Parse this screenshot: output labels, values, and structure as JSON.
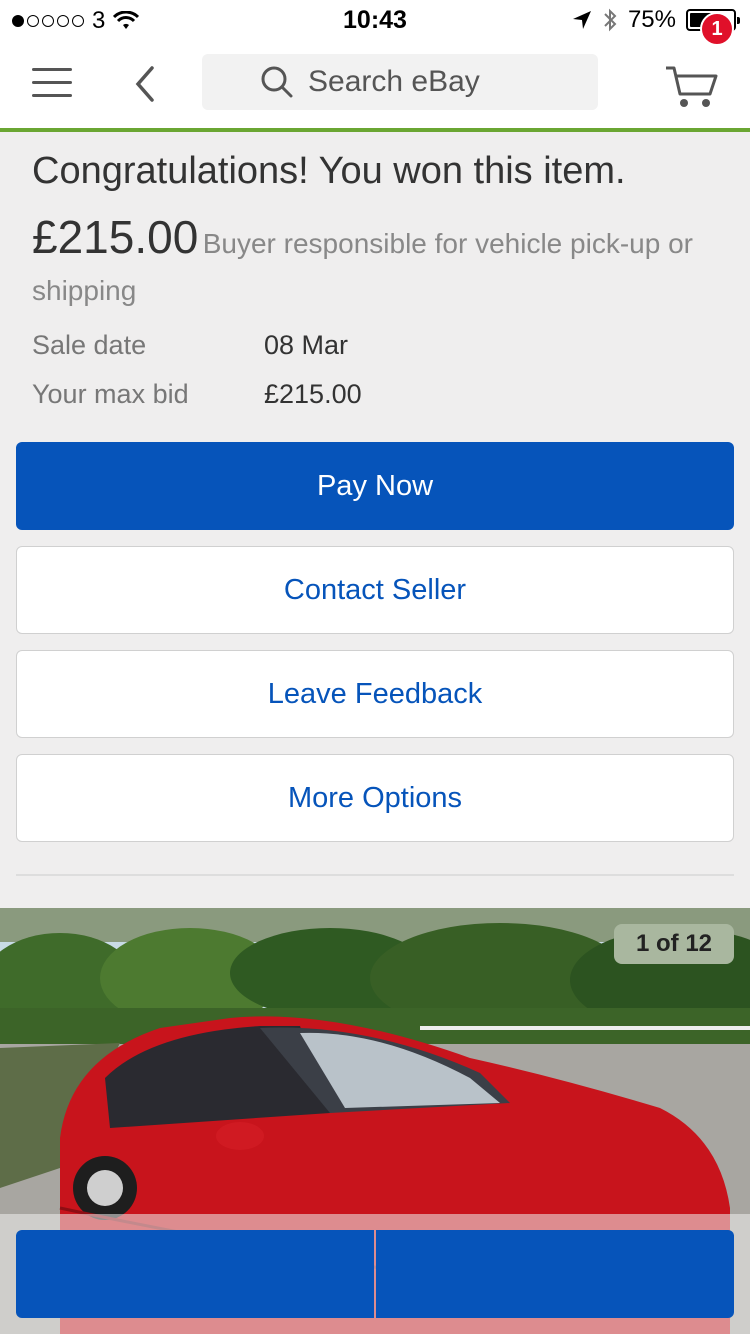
{
  "status_bar": {
    "carrier": "3",
    "time": "10:43",
    "battery": "75%",
    "battery_level": 0.75
  },
  "header": {
    "search_placeholder": "Search eBay",
    "cart_count": "1",
    "icons": [
      "hamburger-menu-icon",
      "back-chevron-icon",
      "search-icon",
      "cart-icon"
    ]
  },
  "won": {
    "title": "Congratulations! You won this item.",
    "price": "£215.00",
    "shipping_note": "Buyer responsible for vehicle pick-up or shipping"
  },
  "details": [
    {
      "label": "Sale date",
      "value": "08 Mar"
    },
    {
      "label": "Your max bid",
      "value": "£215.00"
    }
  ],
  "actions": {
    "pay_now": "Pay Now",
    "contact_seller": "Contact Seller",
    "leave_feedback": "Leave Feedback",
    "more_options": "More Options"
  },
  "gallery": {
    "counter": "1 of 12"
  },
  "colors": {
    "primary_blue": "#0654ba",
    "accent_green": "#6aa632",
    "badge_red": "#e0102a"
  }
}
